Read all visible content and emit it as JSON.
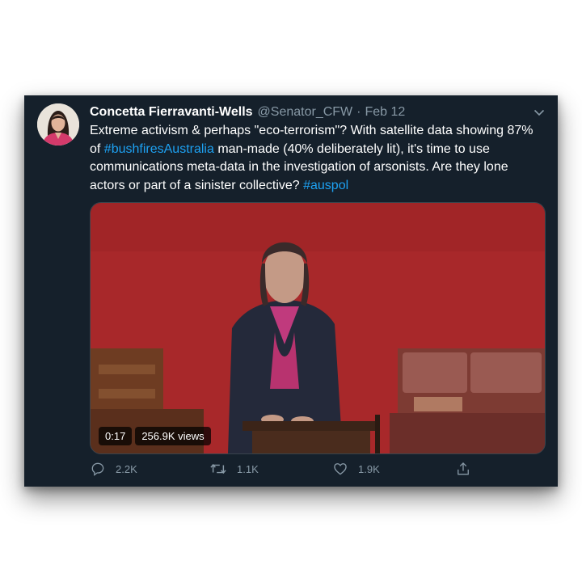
{
  "tweet": {
    "author_name": "Concetta Fierravanti-Wells",
    "handle": "@Senator_CFW",
    "separator": "·",
    "date": "Feb 12",
    "text": {
      "part1": "Extreme activism & perhaps \"eco-terrorism\"? With satellite data showing 87% of ",
      "hashtag1": "#bushfiresAustralia",
      "part2": " man-made (40% deliberately lit), it's time to use communications meta-data in the investigation of arsonists.  Are they lone actors or part of a sinister collective? ",
      "hashtag2": "#auspol"
    },
    "video": {
      "duration": "0:17",
      "views": "256.9K views"
    },
    "actions": {
      "replies": "2.2K",
      "retweets": "1.1K",
      "likes": "1.9K"
    }
  },
  "icons": [
    "chevron-down-icon",
    "reply-icon",
    "retweet-icon",
    "like-icon",
    "share-icon"
  ],
  "colors": {
    "background": "#15202b",
    "text": "#ffffff",
    "secondary_text": "#8899a6",
    "link": "#1da1f2",
    "chamber_red": "#a8282a"
  }
}
